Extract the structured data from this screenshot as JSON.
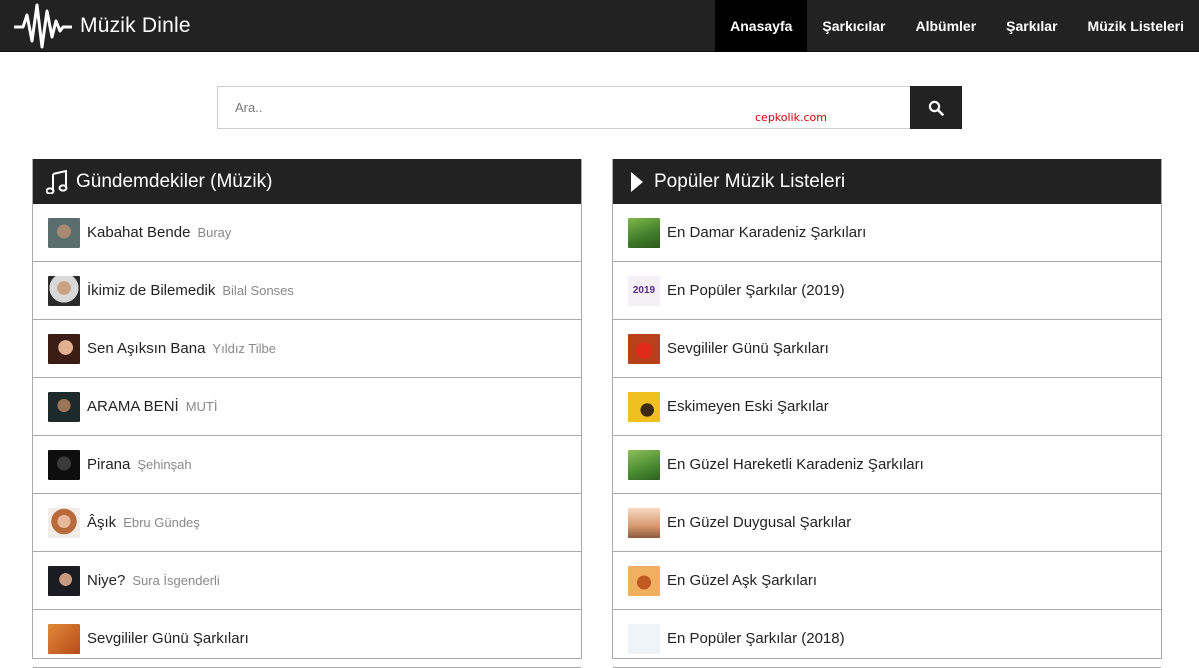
{
  "header": {
    "brand": "Müzik Dinle",
    "nav": [
      {
        "label": "Anasayfa",
        "active": true
      },
      {
        "label": "Şarkıcılar",
        "active": false
      },
      {
        "label": "Albümler",
        "active": false
      },
      {
        "label": "Şarkılar",
        "active": false
      },
      {
        "label": "Müzik Listeleri",
        "active": false
      }
    ]
  },
  "search": {
    "placeholder": "Ara..",
    "value": "",
    "watermark": "cepkolik.com"
  },
  "trending": {
    "title": "Gündemdekiler (Müzik)",
    "icon": "music-note-icon",
    "items": [
      {
        "title": "Kabahat Bende",
        "artist": "Buray"
      },
      {
        "title": "İkimiz de Bilemedik",
        "artist": "Bilal Sonses"
      },
      {
        "title": "Sen Aşıksın Bana",
        "artist": "Yıldız Tilbe"
      },
      {
        "title": "ARAMA BENİ",
        "artist": "MUTİ"
      },
      {
        "title": "Pirana",
        "artist": "Şehinşah"
      },
      {
        "title": "Âşık",
        "artist": "Ebru Gündeş"
      },
      {
        "title": "Niye?",
        "artist": "Sura İsgenderli"
      },
      {
        "title": "Sevgililer Günü Şarkıları",
        "artist": ""
      }
    ]
  },
  "playlists": {
    "title": "Popüler Müzik Listeleri",
    "icon": "play-icon",
    "items": [
      {
        "title": "En Damar Karadeniz Şarkıları"
      },
      {
        "title": "En Popüler Şarkılar (2019)"
      },
      {
        "title": "Sevgililer Günü Şarkıları"
      },
      {
        "title": "Eskimeyen Eski Şarkılar"
      },
      {
        "title": "En Güzel Hareketli Karadeniz Şarkıları"
      },
      {
        "title": "En Güzel Duygusal Şarkılar"
      },
      {
        "title": "En Güzel Aşk Şarkıları"
      },
      {
        "title": "En Popüler Şarkılar (2018)"
      }
    ]
  },
  "colors": {
    "header_bg": "#222222",
    "active_nav_bg": "#000000",
    "watermark": "#d40000"
  }
}
